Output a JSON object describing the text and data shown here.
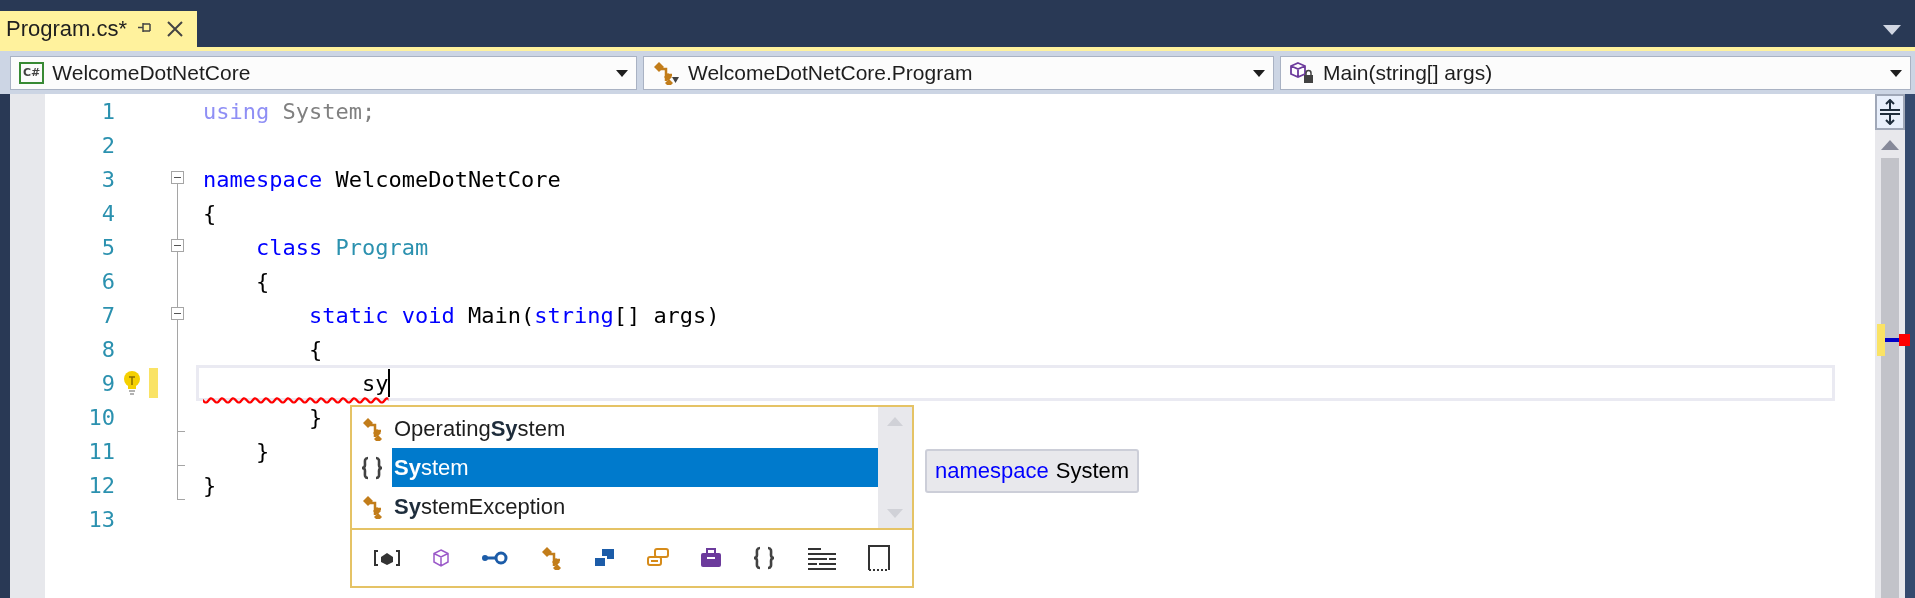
{
  "tab": {
    "title": "Program.cs*",
    "selected": true
  },
  "navigation": [
    {
      "kind": "project",
      "badge": "C#",
      "text": "WelcomeDotNetCore"
    },
    {
      "kind": "class",
      "text": "WelcomeDotNetCore.Program"
    },
    {
      "kind": "method",
      "text": "Main(string[] args)"
    }
  ],
  "editor": {
    "lines": [
      {
        "number": "1",
        "kind": "none",
        "current": false,
        "lightbulb": false,
        "modified": false,
        "tokens": [
          {
            "text": "using",
            "kind": "faded-keyword"
          },
          {
            "text": " System;",
            "kind": "faded"
          }
        ]
      },
      {
        "number": "2",
        "kind": "none",
        "current": false,
        "lightbulb": false,
        "modified": false
      },
      {
        "number": "3",
        "kind": "start",
        "current": false,
        "lightbulb": false,
        "modified": false,
        "tokens": [
          {
            "text": "namespace",
            "kind": "keyword"
          },
          {
            "text": " WelcomeDotNetCore",
            "kind": "plain"
          }
        ]
      },
      {
        "number": "4",
        "kind": "inside",
        "current": false,
        "lightbulb": false,
        "modified": false,
        "tokens": [
          {
            "text": "{",
            "kind": "plain"
          }
        ]
      },
      {
        "number": "5",
        "kind": "start",
        "current": false,
        "lightbulb": false,
        "modified": false,
        "tokens": [
          {
            "text": "    class",
            "kind": "keyword"
          },
          {
            "text": " Program",
            "kind": "type"
          }
        ]
      },
      {
        "number": "6",
        "kind": "inside",
        "current": false,
        "lightbulb": false,
        "modified": false,
        "tokens": [
          {
            "text": "    {",
            "kind": "plain"
          }
        ]
      },
      {
        "number": "7",
        "kind": "start",
        "current": false,
        "lightbulb": false,
        "modified": false,
        "tokens": [
          {
            "text": "        static void",
            "kind": "keyword"
          },
          {
            "text": " Main(",
            "kind": "plain"
          },
          {
            "text": "string",
            "kind": "keyword"
          },
          {
            "text": "[] args)",
            "kind": "plain"
          }
        ]
      },
      {
        "number": "8",
        "kind": "inside",
        "current": false,
        "lightbulb": false,
        "modified": false,
        "tokens": [
          {
            "text": "        {",
            "kind": "plain"
          }
        ]
      },
      {
        "number": "9",
        "kind": "inside",
        "current": true,
        "lightbulb": true,
        "modified": true,
        "tokens": [
          {
            "text": "            sy",
            "kind": "error"
          }
        ]
      },
      {
        "number": "10",
        "kind": "end",
        "current": false,
        "lightbulb": false,
        "modified": false,
        "tokens": [
          {
            "text": "        }",
            "kind": "plain"
          }
        ]
      },
      {
        "number": "11",
        "kind": "end",
        "current": false,
        "lightbulb": false,
        "modified": false,
        "tokens": [
          {
            "text": "    }",
            "kind": "plain"
          }
        ]
      },
      {
        "number": "12",
        "kind": "end",
        "current": false,
        "lightbulb": false,
        "modified": false,
        "tokens": [
          {
            "text": "}",
            "kind": "plain"
          }
        ]
      },
      {
        "number": "13",
        "kind": "none",
        "current": false,
        "lightbulb": false,
        "modified": false
      }
    ]
  },
  "completion": {
    "items": [
      {
        "kind": "class",
        "text": "Operating**Sy**stem",
        "selected": false
      },
      {
        "kind": "namespace",
        "text": "**Sy**stem",
        "selected": true
      },
      {
        "kind": "class",
        "text": "**Sy**stemException",
        "selected": false
      }
    ],
    "tooltip": {
      "keyword": "namespace",
      "name": "System"
    }
  }
}
